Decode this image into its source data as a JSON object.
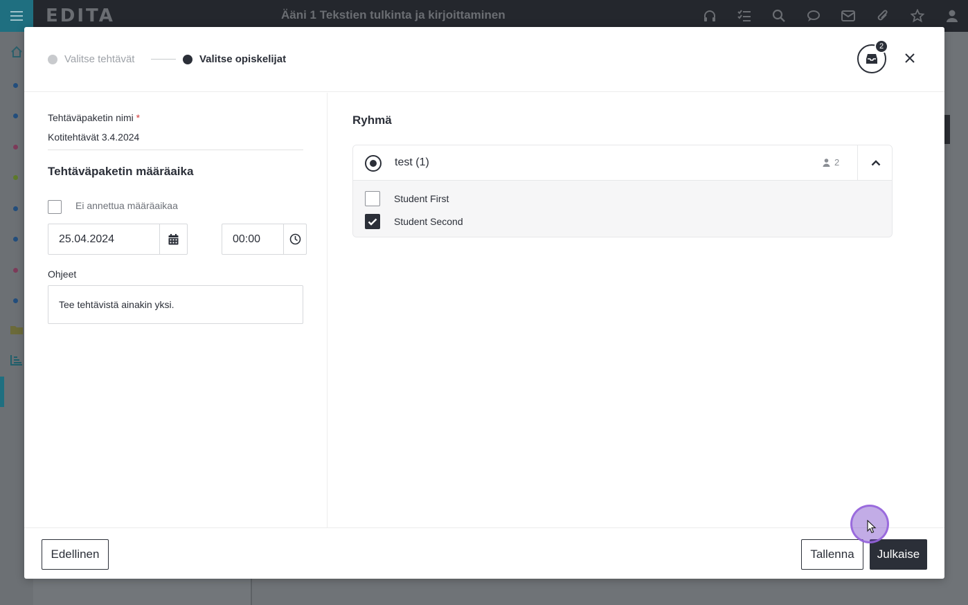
{
  "app": {
    "logo": "EDITA",
    "title": "Ääni 1 Tekstien tulkinta ja kirjoittaminen",
    "top_icons": [
      "headphones-icon",
      "tasks-icon",
      "search-icon",
      "chat-icon",
      "mail-icon",
      "attachment-icon",
      "star-icon",
      "user-icon"
    ]
  },
  "modal": {
    "steps": [
      {
        "label": "Valitse tehtävät",
        "state": "done"
      },
      {
        "label": "Valitse opiskelijat",
        "state": "active"
      }
    ],
    "inbox_badge": "2",
    "left": {
      "name_label": "Tehtäväpaketin nimi",
      "required_mark": "*",
      "name_value": "Kotitehtävät 3.4.2024",
      "deadline_title": "Tehtäväpaketin määräaika",
      "no_deadline_label": "Ei annettua määräaikaa",
      "no_deadline_checked": false,
      "date_value": "25.04.2024",
      "time_value": "00:00",
      "instructions_label": "Ohjeet",
      "instructions_value": "Tee tehtävistä ainakin yksi."
    },
    "right": {
      "title": "Ryhmä",
      "group": {
        "name": "test (1)",
        "member_count": "2",
        "selected": true,
        "expanded": true,
        "students": [
          {
            "name": "Student First",
            "checked": false
          },
          {
            "name": "Student Second",
            "checked": true
          }
        ]
      }
    },
    "footer": {
      "previous_label": "Edellinen",
      "save_label": "Tallenna",
      "publish_label": "Julkaise"
    }
  },
  "colors": {
    "primary_dark": "#2b2f38",
    "accent_teal": "#1f6f80",
    "required_red": "#d03b3b"
  }
}
